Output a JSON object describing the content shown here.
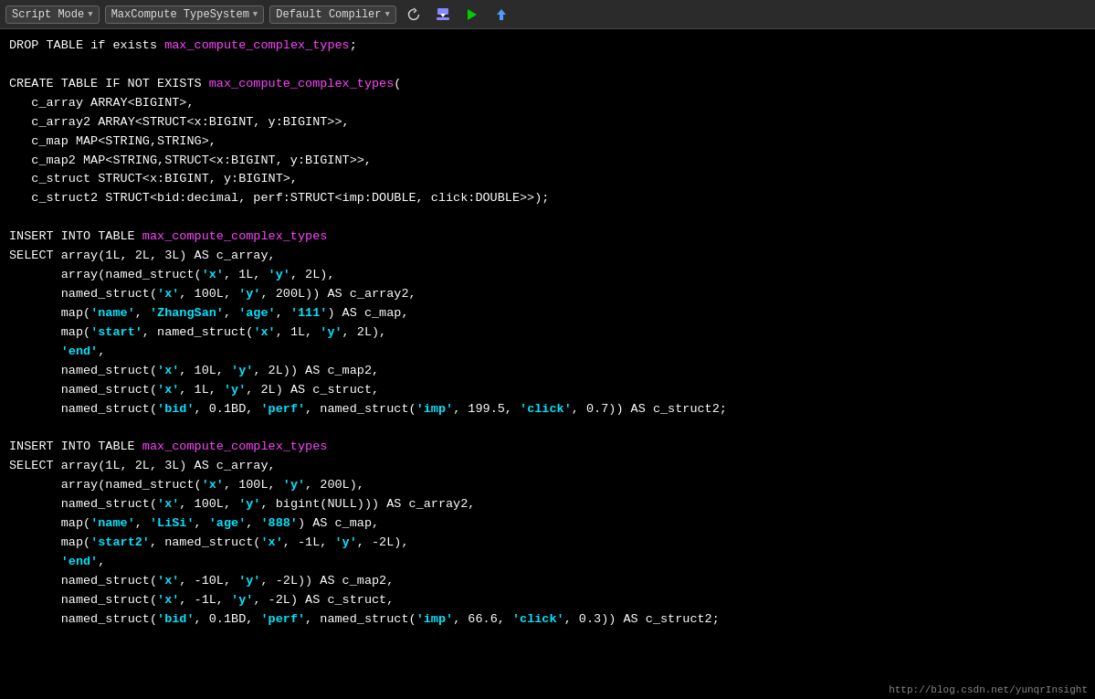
{
  "toolbar": {
    "script_mode_label": "Script Mode",
    "type_system_label": "MaxCompute TypeSystem",
    "compiler_label": "Default Compiler",
    "dropdown_arrow": "▼"
  },
  "watermark": "http://blog.csdn.net/yunqrInsight"
}
